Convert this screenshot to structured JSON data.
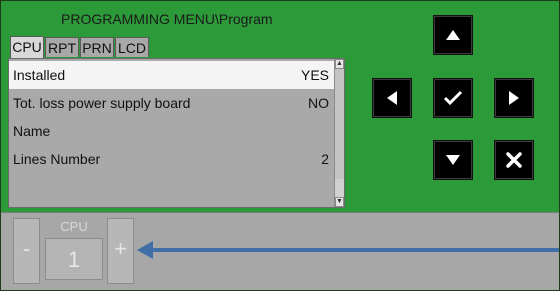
{
  "header": {
    "title": "PROGRAMMING MENU\\Program"
  },
  "tabs": [
    {
      "label": "CPU"
    },
    {
      "label": "RPT"
    },
    {
      "label": "PRN"
    },
    {
      "label": "LCD"
    }
  ],
  "list": {
    "rows": [
      {
        "label": "Installed",
        "value": "YES"
      },
      {
        "label": "Tot. loss power supply board",
        "value": "NO"
      },
      {
        "label": "Name",
        "value": ""
      },
      {
        "label": "Lines Number",
        "value": "2"
      }
    ]
  },
  "nav": {
    "up_icon": "arrow-up",
    "left_icon": "arrow-left",
    "confirm_icon": "checkmark",
    "right_icon": "arrow-right",
    "down_icon": "arrow-down",
    "cancel_icon": "x-cancel"
  },
  "stepper": {
    "label": "CPU",
    "value": "1",
    "minus": "-",
    "plus": "+"
  },
  "colors": {
    "background": "#2d9a3a",
    "panel": "#a9a9a9",
    "selected_row": "#f4f4f4",
    "nav_button": "#000000",
    "arrow": "#3f6fa6"
  }
}
